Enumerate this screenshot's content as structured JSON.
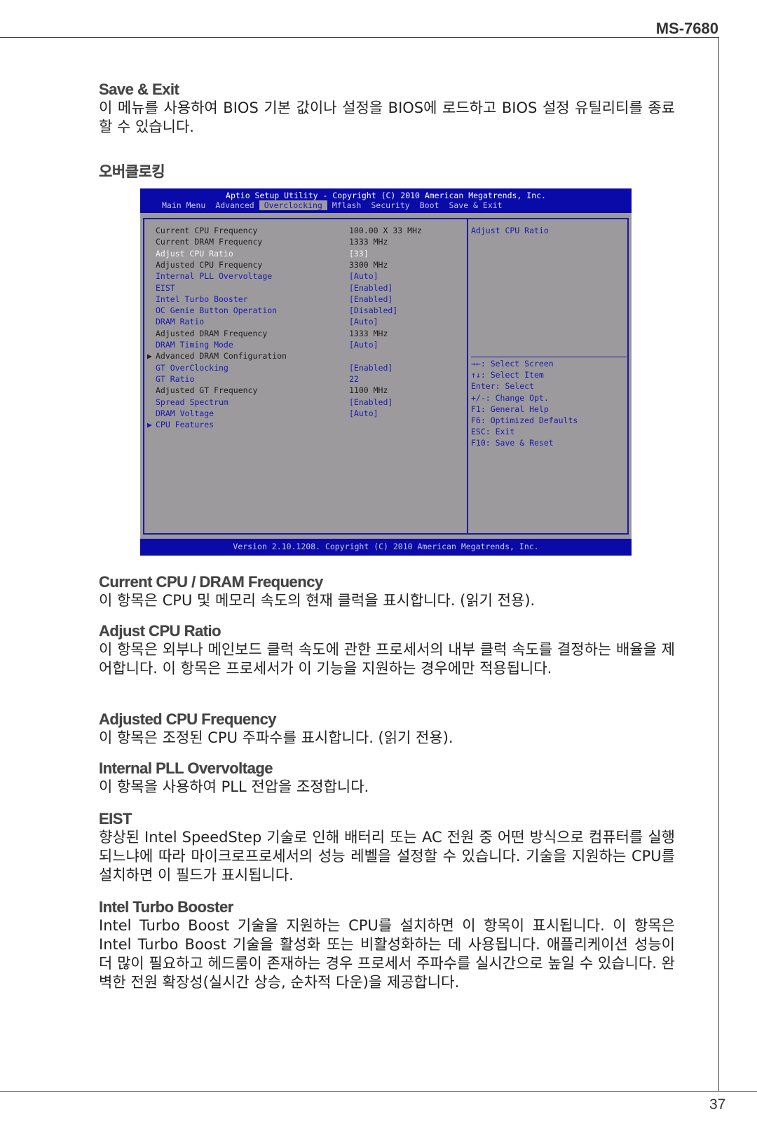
{
  "header": {
    "model": "MS-7680"
  },
  "page_number": "37",
  "intro": {
    "title": "Save & Exit",
    "text": "이 메뉴를 사용하여 BIOS 기본 값이나 설정을 BIOS에 로드하고 BIOS 설정 유틸리티를 종료할 수 있습니다."
  },
  "section_title": "오버클로킹",
  "bios": {
    "title": "Aptio Setup Utility - Copyright (C) 2010 American Megatrends, Inc.",
    "tabs": [
      "Main Menu",
      "Advanced",
      "Overclocking",
      "Mflash",
      "Security",
      "Boot",
      "Save & Exit"
    ],
    "active_tab": "Overclocking",
    "items": [
      {
        "label": "Current CPU Frequency",
        "value": "100.00 X 33 MHz",
        "style": "dark"
      },
      {
        "label": "Current DRAM Frequency",
        "value": "1333 MHz",
        "style": "dark"
      },
      {
        "label": "Adjust CPU Ratio",
        "value": "[33]",
        "style": "white"
      },
      {
        "label": "Adjusted CPU Frequency",
        "value": "3300 MHz",
        "style": "dark"
      },
      {
        "label": "Internal PLL Overvoltage",
        "value": "[Auto]",
        "style": "blue"
      },
      {
        "label": "EIST",
        "value": "[Enabled]",
        "style": "blue"
      },
      {
        "label": "Intel Turbo Booster",
        "value": "[Enabled]",
        "style": "blue"
      },
      {
        "label": "OC Genie Button Operation",
        "value": "[Disabled]",
        "style": "blue"
      },
      {
        "label": "DRAM Ratio",
        "value": "[Auto]",
        "style": "blue"
      },
      {
        "label": "Adjusted DRAM Frequency",
        "value": "1333 MHz",
        "style": "dark"
      },
      {
        "label": "DRAM Timing Mode",
        "value": "[Auto]",
        "style": "blue"
      },
      {
        "label": "Advanced DRAM Configuration",
        "value": "",
        "style": "dark",
        "submenu": true
      },
      {
        "label": "GT OverClocking",
        "value": "[Enabled]",
        "style": "blue"
      },
      {
        "label": "GT Ratio",
        "value": "22",
        "style": "blue"
      },
      {
        "label": "Adjusted GT Frequency",
        "value": "1100 MHz",
        "style": "dark"
      },
      {
        "label": "Spread Spectrum",
        "value": "[Enabled]",
        "style": "blue"
      },
      {
        "label": "DRAM Voltage",
        "value": "[Auto]",
        "style": "blue"
      },
      {
        "label": "CPU Features",
        "value": "",
        "style": "blue",
        "submenu": true
      }
    ],
    "help_title": "Adjust CPU Ratio",
    "keys": [
      "→←: Select Screen",
      "↑↓: Select Item",
      "Enter: Select",
      "+/-: Change Opt.",
      "F1: General Help",
      "F6: Optimized Defaults",
      "ESC: Exit",
      "F10: Save & Reset"
    ],
    "footer": "Version 2.10.1208. Copyright (C) 2010 American Megatrends, Inc.",
    "colors": {
      "bar": "#0a0aa8",
      "panel": "#9c9a9c",
      "text_blue": "#1a1ab0"
    }
  },
  "sections": [
    {
      "title": "Current CPU / DRAM Frequency",
      "text": "이 항목은 CPU 및 메모리 속도의 현재 클럭을 표시합니다. (읽기 전용)."
    },
    {
      "title": "Adjust CPU Ratio",
      "text": "이 항목은 외부나 메인보드 클럭 속도에 관한 프로세서의 내부 클럭 속도를 결정하는 배율을 제어합니다. 이 항목은 프로세서가 이 기능을 지원하는 경우에만 적용됩니다."
    },
    {
      "title": "Adjusted CPU Frequency",
      "text": "이 항목은 조정된 CPU 주파수를 표시합니다. (읽기 전용)."
    },
    {
      "title": "Internal PLL Overvoltage",
      "text": "이 항목을 사용하여 PLL 전압을 조정합니다."
    },
    {
      "title": "EIST",
      "text": "향상된 Intel SpeedStep 기술로 인해 배터리 또는 AC 전원 중 어떤 방식으로 컴퓨터를 실행되느냐에 따라 마이크로프로세서의 성능 레벨을 설정할 수 있습니다. 기술을 지원하는 CPU를 설치하면 이 필드가 표시됩니다."
    },
    {
      "title": "Intel Turbo Booster",
      "text": "Intel Turbo Boost 기술을 지원하는 CPU를 설치하면 이 항목이 표시됩니다. 이 항목은 Intel Turbo Boost 기술을 활성화 또는 비활성화하는 데 사용됩니다. 애플리케이션 성능이 더 많이 필요하고 헤드룸이 존재하는 경우 프로세서 주파수를 실시간으로 높일 수 있습니다. 완벽한 전원 확장성(실시간 상승, 순차적 다운)을 제공합니다."
    }
  ]
}
